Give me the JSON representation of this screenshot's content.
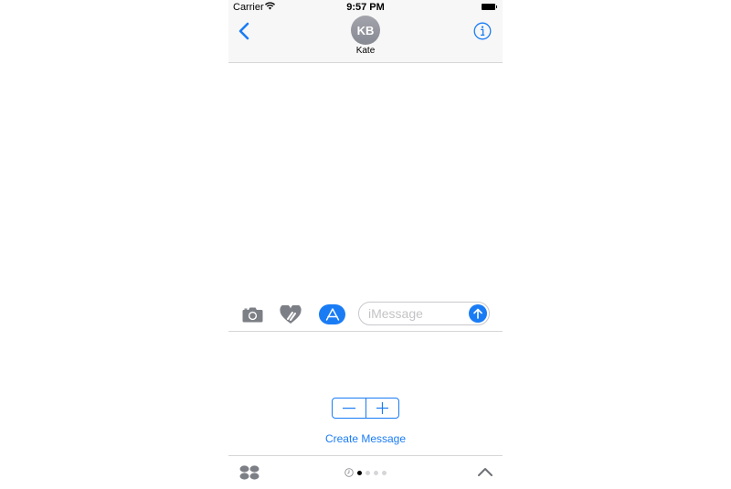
{
  "status_bar": {
    "carrier": "Carrier",
    "time": "9:57 PM",
    "wifi_icon": "wifi-icon",
    "battery_icon": "battery-icon"
  },
  "nav": {
    "back_icon": "chevron-left-icon",
    "avatar_initials": "KB",
    "contact_name": "Kate",
    "info_icon": "info-icon"
  },
  "composer": {
    "camera_icon": "camera-icon",
    "digital_touch_icon": "heart-touch-icon",
    "app_store_icon": "app-store-icon",
    "message_placeholder": "iMessage",
    "message_value": "",
    "send_icon": "arrow-up-icon"
  },
  "extension": {
    "stepper_minus": "−",
    "stepper_plus": "+",
    "create_message_label": "Create Message"
  },
  "bottom_bar": {
    "app_drawer_icon": "app-grid-icon",
    "recents_icon": "clock-icon",
    "page_count": 4,
    "active_page": 1,
    "expand_icon": "chevron-up-icon"
  },
  "colors": {
    "accent": "#1a7cf5",
    "avatar": "#8e8f97",
    "icon_gray": "#7d7f86",
    "navbar_bg": "#f7f7f7"
  }
}
